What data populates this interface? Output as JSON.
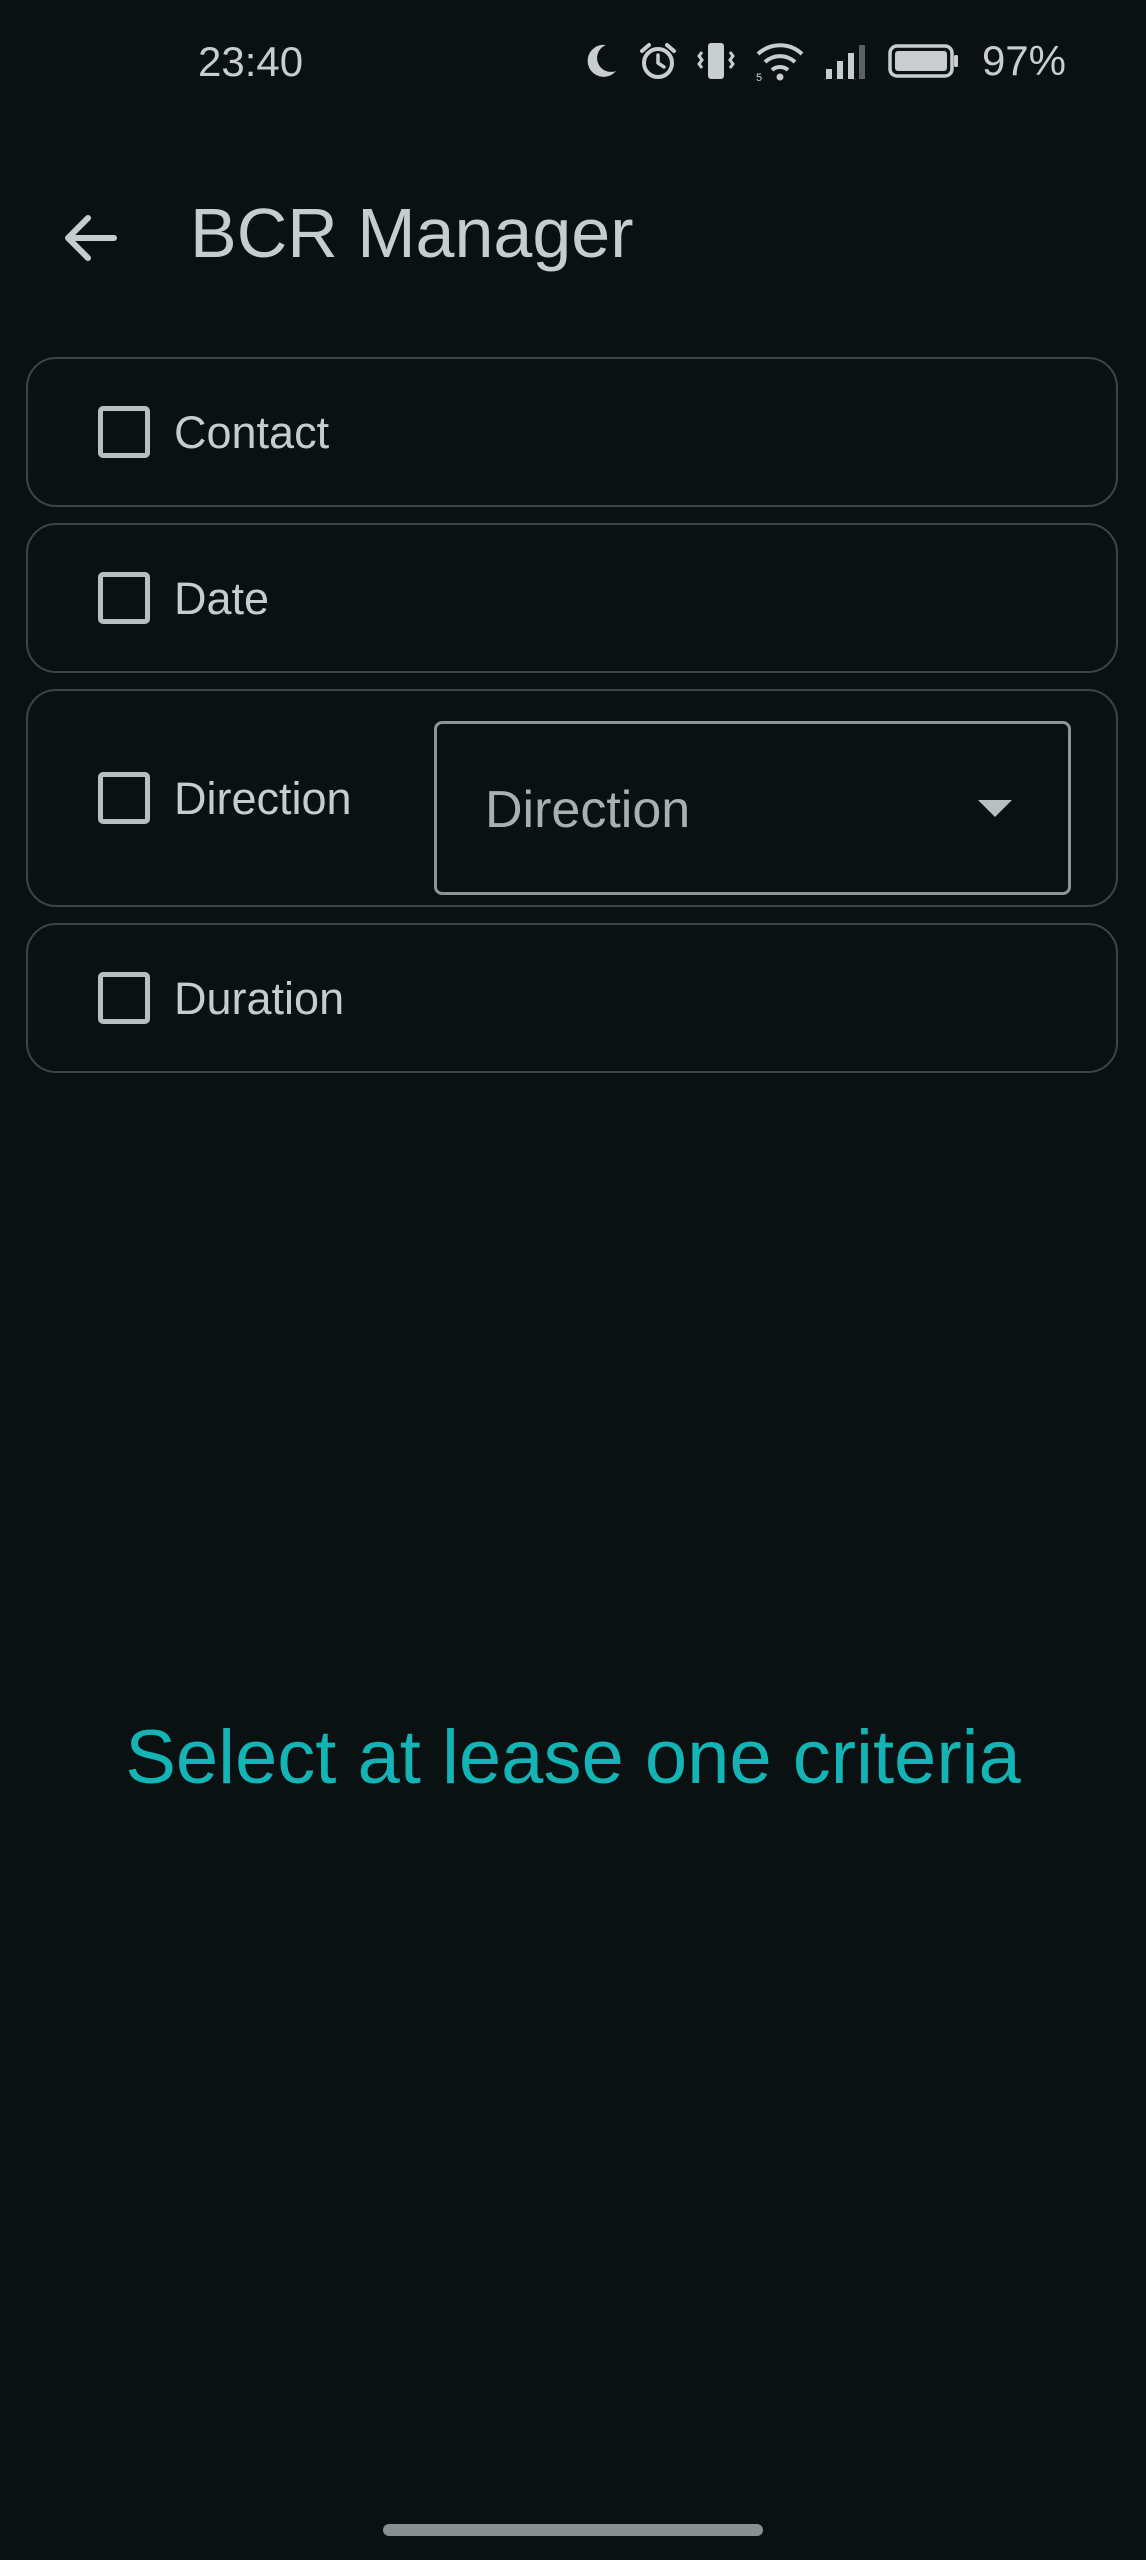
{
  "status_bar": {
    "time": "23:40",
    "battery": "97%",
    "icons": [
      "moon-icon",
      "alarm-icon",
      "vibrate-icon",
      "wifi-icon",
      "signal-icon",
      "battery-icon"
    ]
  },
  "app_bar": {
    "back_icon": "arrow-back-icon",
    "title": "BCR Manager"
  },
  "criteria": {
    "contact": {
      "label": "Contact",
      "checked": false
    },
    "date": {
      "label": "Date",
      "checked": false
    },
    "direction": {
      "label": "Direction",
      "checked": false,
      "dropdown_value": "Direction"
    },
    "duration": {
      "label": "Duration",
      "checked": false
    }
  },
  "empty_state": {
    "message": "Select at lease one criteria"
  },
  "colors": {
    "background": "#091113",
    "accent": "#14b3b6",
    "text": "#c7cccc",
    "card_border": "#3a4546"
  }
}
